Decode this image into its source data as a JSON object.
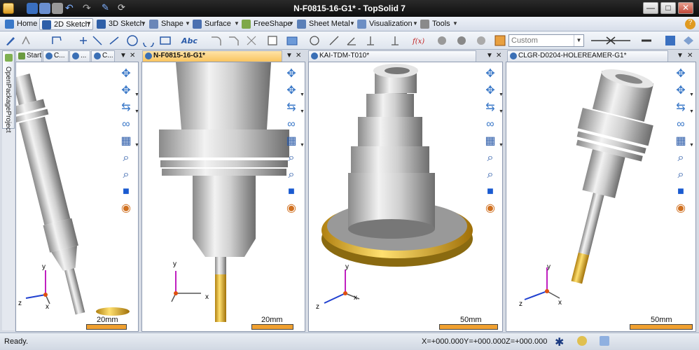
{
  "window": {
    "title": "N-F0815-16-G1* - TopSolid 7",
    "controls": {
      "minimize": "—",
      "maximize": "□",
      "close": "✕"
    }
  },
  "menu": {
    "items": [
      {
        "label": "Home",
        "icon": "home-icon",
        "color": "#3a78c8"
      },
      {
        "label": "2D Sketch",
        "icon": "pencil-icon",
        "color": "#2e5fa8",
        "active": true
      },
      {
        "label": "3D Sketch",
        "icon": "pencil-3d-icon",
        "color": "#2e5fa8"
      },
      {
        "label": "Shape",
        "icon": "shape-icon",
        "color": "#6a86b8"
      },
      {
        "label": "Surface",
        "icon": "surface-icon",
        "color": "#4a6fb0"
      },
      {
        "label": "FreeShape",
        "icon": "freeshape-icon",
        "color": "#7ea84a"
      },
      {
        "label": "Sheet Metal",
        "icon": "sheet-metal-icon",
        "color": "#5a7fb8"
      },
      {
        "label": "Visualization",
        "icon": "visualization-icon",
        "color": "#6c8ec4"
      },
      {
        "label": "Tools",
        "icon": "tools-icon",
        "color": "#8a8a8a"
      }
    ]
  },
  "toolbar": {
    "style_combo": "Custom"
  },
  "side_panel": {
    "label": "OpenPackageProject"
  },
  "tabs": {
    "left_group": [
      {
        "label": "Start ..."
      },
      {
        "label": "C..."
      },
      {
        "label": "..."
      },
      {
        "label": "C..."
      }
    ],
    "active": "N-F0815-16-G1*",
    "third": "KAI-TDM-T010*",
    "fourth": "CLGR-D0204-HOLEREAMER-G1*"
  },
  "viewports": [
    {
      "scale": "20mm"
    },
    {
      "scale": "20mm"
    },
    {
      "scale": "50mm"
    },
    {
      "scale": "50mm"
    }
  ],
  "axes": {
    "x": "x",
    "y": "y",
    "z": "z"
  },
  "status": {
    "text": "Ready.",
    "x": "X=+000.000",
    "y": "Y=+000.000",
    "z": "Z=+000.000"
  },
  "colors": {
    "accent": "#f0a030",
    "title_bar": "#141414",
    "gold": "#e8b830"
  }
}
